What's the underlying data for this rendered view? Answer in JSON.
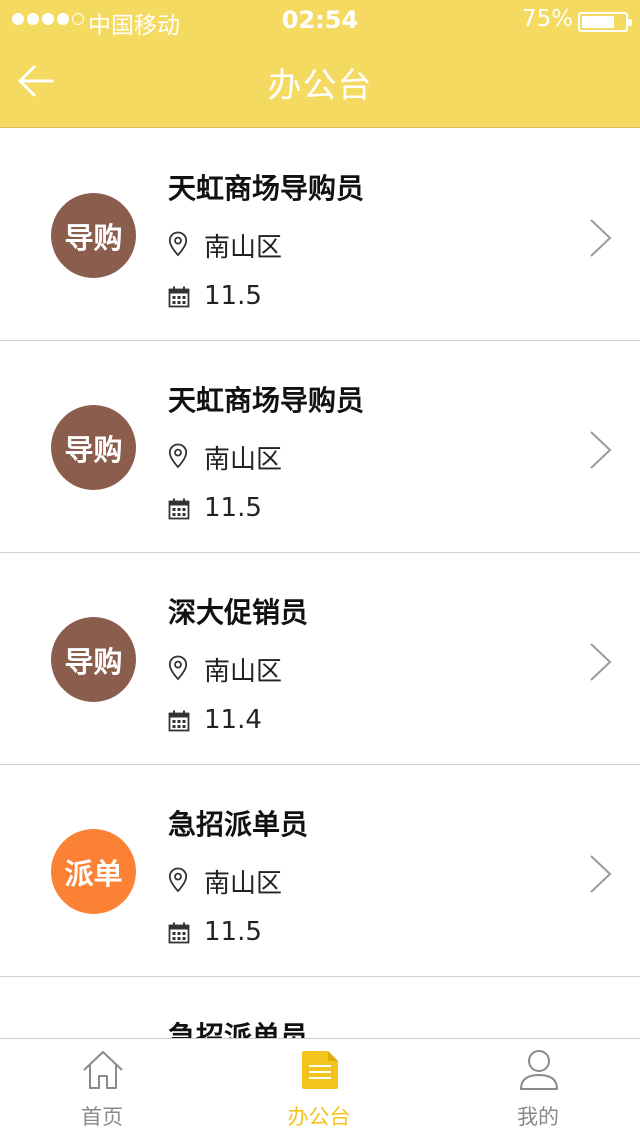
{
  "status_bar": {
    "carrier": "中国移动",
    "time": "02:54",
    "battery": "75%",
    "battery_level": 0.75,
    "signal_bars": 4,
    "signal_total": 5
  },
  "header": {
    "title": "办公台",
    "back_icon": "arrow-left-icon"
  },
  "colors": {
    "header_bg": "#f4da60",
    "badge_brown": "#8b5d4d",
    "badge_orange": "#fb8134",
    "tab_active": "#f4c31e",
    "tab_inactive": "#8a8a8a"
  },
  "jobs": [
    {
      "badge": "导购",
      "badge_color": "#8b5d4d",
      "title": "天虹商场导购员",
      "location": "南山区",
      "date": "11.5"
    },
    {
      "badge": "导购",
      "badge_color": "#8b5d4d",
      "title": "天虹商场导购员",
      "location": "南山区",
      "date": "11.5"
    },
    {
      "badge": "导购",
      "badge_color": "#8b5d4d",
      "title": "深大促销员",
      "location": "南山区",
      "date": "11.4"
    },
    {
      "badge": "派单",
      "badge_color": "#fb8134",
      "title": "急招派单员",
      "location": "南山区",
      "date": "11.5"
    },
    {
      "badge": "",
      "badge_color": "#fb8134",
      "title": "急招派单员",
      "location": "",
      "date": ""
    }
  ],
  "tabs": [
    {
      "label": "首页",
      "icon": "home-icon",
      "active": false
    },
    {
      "label": "办公台",
      "icon": "document-icon",
      "active": true
    },
    {
      "label": "我的",
      "icon": "user-icon",
      "active": false
    }
  ]
}
